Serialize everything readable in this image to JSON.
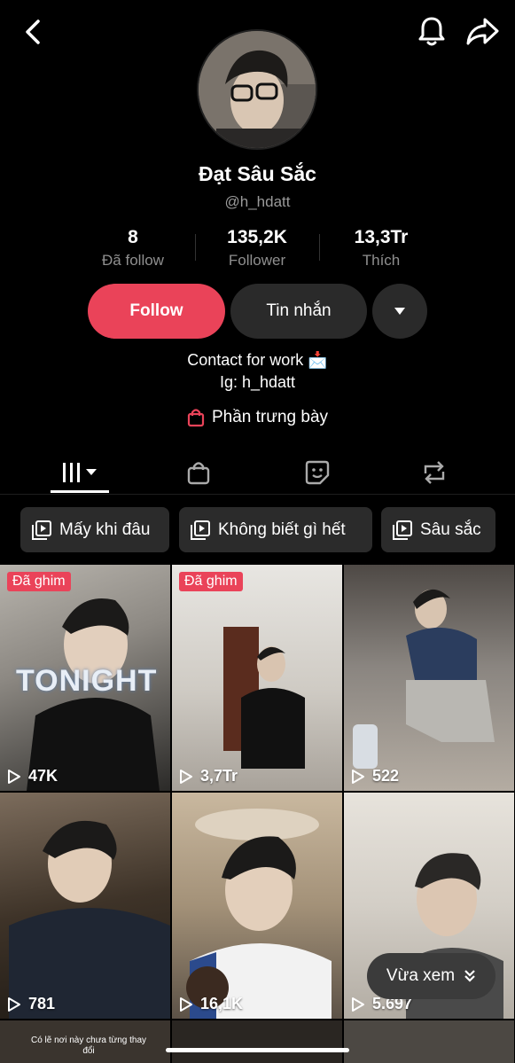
{
  "profile": {
    "name": "Đạt Sâu Sắc",
    "handle": "@h_hdatt"
  },
  "stats": [
    {
      "value": "8",
      "label": "Đã follow"
    },
    {
      "value": "135,2K",
      "label": "Follower"
    },
    {
      "value": "13,3Tr",
      "label": "Thích"
    }
  ],
  "actions": {
    "follow_label": "Follow",
    "message_label": "Tin nhắn"
  },
  "bio": {
    "line1": "Contact for work 📩",
    "line2": "Ig: h_hdatt"
  },
  "showcase_label": "Phần trưng bày",
  "playlists": [
    {
      "label": "Mấy khi đâu"
    },
    {
      "label": "Không biết gì hết"
    },
    {
      "label": "Sâu sắc"
    }
  ],
  "videos": [
    {
      "views": "47K",
      "pinned": "Đã ghim",
      "overlay": "TONIGHT"
    },
    {
      "views": "3,7Tr",
      "pinned": "Đã ghim"
    },
    {
      "views": "522"
    },
    {
      "views": "781"
    },
    {
      "views": "16,1K"
    },
    {
      "views": "5.697"
    }
  ],
  "bottom_caption": "Có lẽ nơi này chưa từng thay đổi",
  "recently_watched_label": "Vừa xem",
  "colors": {
    "accent": "#ea4359",
    "background": "#000000",
    "button_secondary": "#2a2a2a"
  }
}
